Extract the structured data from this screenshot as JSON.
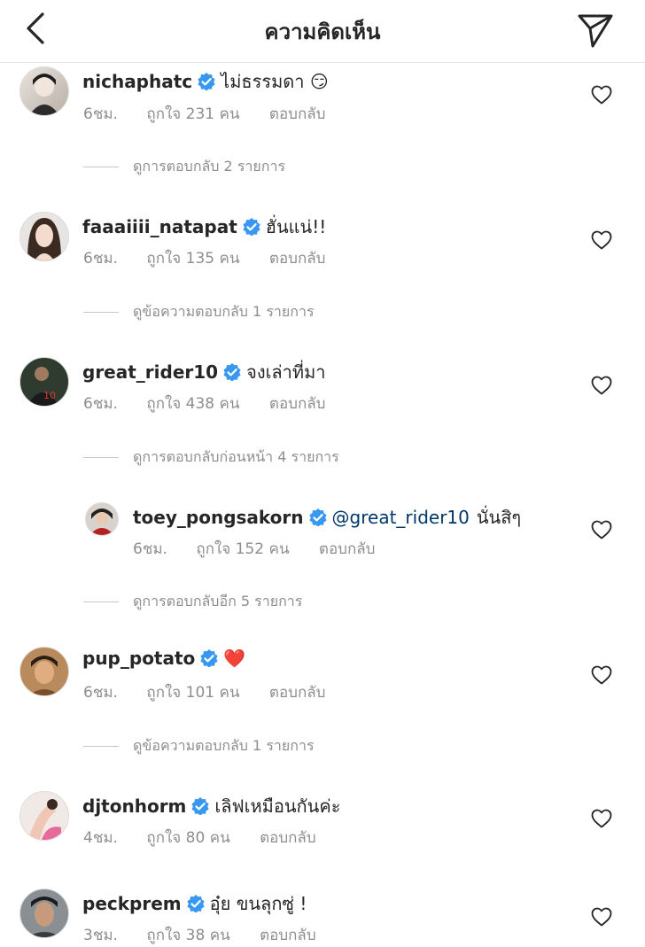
{
  "header": {
    "title": "ความคิดเห็น",
    "back_icon": "chevron-left-icon",
    "send_icon": "paper-plane-icon"
  },
  "comments": [
    {
      "username": "nichaphatc",
      "text": "ไม่ธรรมดา 😏",
      "time": "6ชม.",
      "likes": "ถูกใจ 231 คน",
      "reply": "ตอบกลับ",
      "view_replies": "ดูการตอบกลับ 2 รายการ"
    },
    {
      "username": "faaaiiii_natapat",
      "text": "ฮั่นแน่!!",
      "time": "6ชม.",
      "likes": "ถูกใจ 135 คน",
      "reply": "ตอบกลับ",
      "view_replies": "ดูข้อความตอบกลับ 1 รายการ"
    },
    {
      "username": "great_rider10",
      "text": "จงเล่าที่มา",
      "time": "6ชม.",
      "likes": "ถูกใจ 438 คน",
      "reply": "ตอบกลับ",
      "view_replies": "ดูการตอบกลับก่อนหน้า 4 รายการ"
    },
    {
      "username": "toey_pongsakorn",
      "mention": "@great_rider10",
      "text": "นั่นสิๆ",
      "time": "6ชม.",
      "likes": "ถูกใจ 152 คน",
      "reply": "ตอบกลับ",
      "view_replies": "ดูการตอบกลับอีก 5 รายการ"
    },
    {
      "username": "pup_potato",
      "text": "❤️",
      "time": "6ชม.",
      "likes": "ถูกใจ 101 คน",
      "reply": "ตอบกลับ",
      "view_replies": "ดูข้อความตอบกลับ 1 รายการ"
    },
    {
      "username": "djtonhorm",
      "text": "เลิฟเหมือนกันค่ะ",
      "time": "4ชม.",
      "likes": "ถูกใจ 80 คน",
      "reply": "ตอบกลับ"
    },
    {
      "username": "peckprem",
      "text": "อุ๋ย ขนลุกซู่ !",
      "time": "3ชม.",
      "likes": "ถูกใจ 38 คน",
      "reply": "ตอบกลับ"
    }
  ],
  "colors": {
    "verified_badge": "#3897f0",
    "secondary_text": "#8e8e8e",
    "mention": "#00376b"
  }
}
